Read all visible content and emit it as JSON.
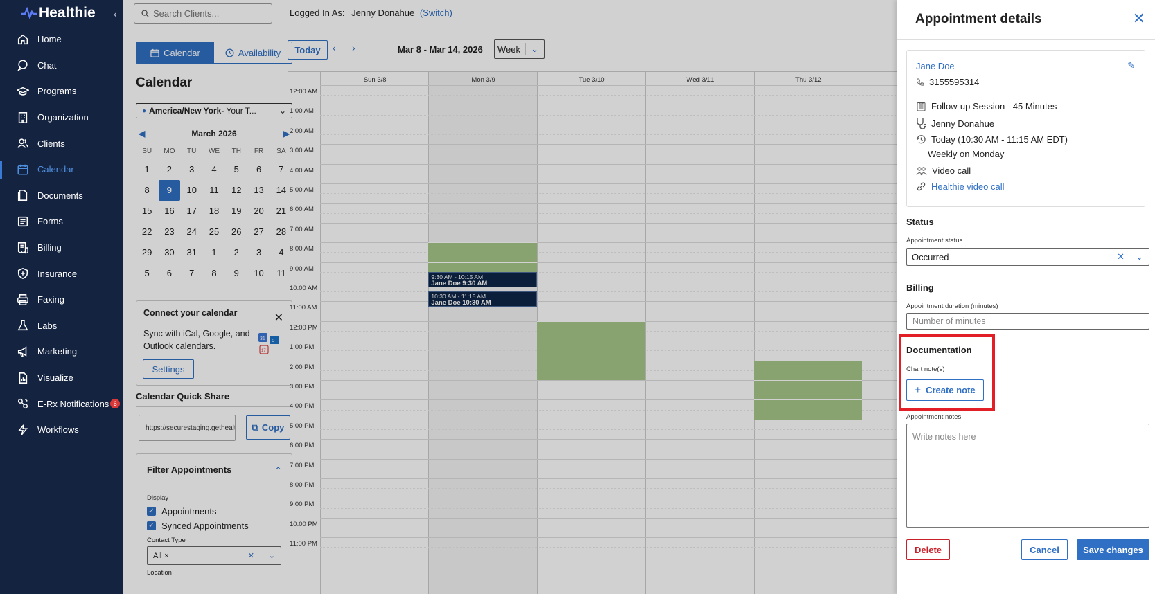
{
  "brand": {
    "name": "Healthie"
  },
  "sidebar": {
    "items": [
      {
        "label": "Home",
        "icon": "home-icon"
      },
      {
        "label": "Chat",
        "icon": "chat-icon"
      },
      {
        "label": "Programs",
        "icon": "programs-icon"
      },
      {
        "label": "Organization",
        "icon": "organization-icon"
      },
      {
        "label": "Clients",
        "icon": "clients-icon"
      },
      {
        "label": "Calendar",
        "icon": "calendar-icon",
        "active": true
      },
      {
        "label": "Documents",
        "icon": "documents-icon"
      },
      {
        "label": "Forms",
        "icon": "forms-icon"
      },
      {
        "label": "Billing",
        "icon": "billing-icon"
      },
      {
        "label": "Insurance",
        "icon": "insurance-icon"
      },
      {
        "label": "Faxing",
        "icon": "fax-icon"
      },
      {
        "label": "Labs",
        "icon": "labs-icon"
      },
      {
        "label": "Marketing",
        "icon": "marketing-icon"
      },
      {
        "label": "Visualize",
        "icon": "visualize-icon"
      },
      {
        "label": "E-Rx Notifications",
        "icon": "erx-icon",
        "badge": "6"
      },
      {
        "label": "Workflows",
        "icon": "workflows-icon"
      }
    ]
  },
  "topbar": {
    "search_placeholder": "Search Clients...",
    "logged_in_label": "Logged In As:",
    "user": "Jenny Donahue",
    "switch_label": "(Switch)"
  },
  "calendar": {
    "tabs": [
      {
        "label": "Calendar"
      },
      {
        "label": "Availability"
      }
    ],
    "title": "Calendar",
    "timezone": {
      "icon": "globe-icon",
      "bold": "America/New York",
      "rest": " - Your T..."
    },
    "mini": {
      "month": "March 2026",
      "dow": [
        "SU",
        "MO",
        "TU",
        "WE",
        "TH",
        "FR",
        "SA"
      ],
      "days": [
        "1",
        "2",
        "3",
        "4",
        "5",
        "6",
        "7",
        "8",
        "9",
        "10",
        "11",
        "12",
        "13",
        "14",
        "15",
        "16",
        "17",
        "18",
        "19",
        "20",
        "21",
        "22",
        "23",
        "24",
        "25",
        "26",
        "27",
        "28",
        "29",
        "30",
        "31",
        "1",
        "2",
        "3",
        "4",
        "5",
        "6",
        "7",
        "8",
        "9",
        "10",
        "11"
      ],
      "today": "9"
    },
    "connect": {
      "title": "Connect your calendar",
      "body": "Sync with iCal, Google, and Outlook calendars.",
      "button": "Settings"
    },
    "quick_share": {
      "title": "Calendar Quick Share",
      "url": "https://securestaging.gethealthie.com",
      "copy": "Copy"
    },
    "filter": {
      "title": "Filter Appointments",
      "display_label": "Display",
      "options": [
        "Appointments",
        "Synced Appointments"
      ],
      "contact_type_label": "Contact Type",
      "contact_type_value": "All",
      "location_label": "Location"
    },
    "toolbar": {
      "today": "Today",
      "range": "Mar 8 - Mar 14, 2026",
      "view": "Week"
    },
    "days": [
      "Sun 3/8",
      "Mon 3/9",
      "Tue 3/10",
      "Wed 3/11",
      "Thu 3/12"
    ],
    "hours": [
      "12:00 AM",
      "1:00 AM",
      "2:00 AM",
      "3:00 AM",
      "4:00 AM",
      "5:00 AM",
      "6:00 AM",
      "7:00 AM",
      "8:00 AM",
      "9:00 AM",
      "10:00 AM",
      "11:00 AM",
      "12:00 PM",
      "1:00 PM",
      "2:00 PM",
      "3:00 PM",
      "4:00 PM",
      "5:00 PM",
      "6:00 PM",
      "7:00 PM",
      "8:00 PM",
      "9:00 PM",
      "10:00 PM",
      "11:00 PM"
    ],
    "appointments": [
      {
        "time": "9:30 AM - 10:15 AM",
        "title": "Jane Doe 9:30 AM"
      },
      {
        "time": "10:30 AM - 11:15 AM",
        "title": "Jane Doe 10:30 AM"
      }
    ]
  },
  "panel": {
    "title": "Appointment details",
    "client_name": "Jane Doe",
    "phone": "3155595314",
    "session": "Follow-up Session - 45 Minutes",
    "provider": "Jenny Donahue",
    "time": "Today (10:30 AM - 11:15 AM EDT)",
    "recurrence": "Weekly on Monday",
    "contact_type": "Video call",
    "video_link": "Healthie video call",
    "status_section": "Status",
    "status_label": "Appointment status",
    "status_value": "Occurred",
    "billing_section": "Billing",
    "duration_label": "Appointment duration (minutes)",
    "duration_placeholder": "Number of minutes",
    "documentation_section": "Documentation",
    "chart_notes_label": "Chart note(s)",
    "create_note": "Create note",
    "notes_label": "Appointment notes",
    "notes_placeholder": "Write notes here",
    "delete": "Delete",
    "cancel": "Cancel",
    "save": "Save changes"
  }
}
